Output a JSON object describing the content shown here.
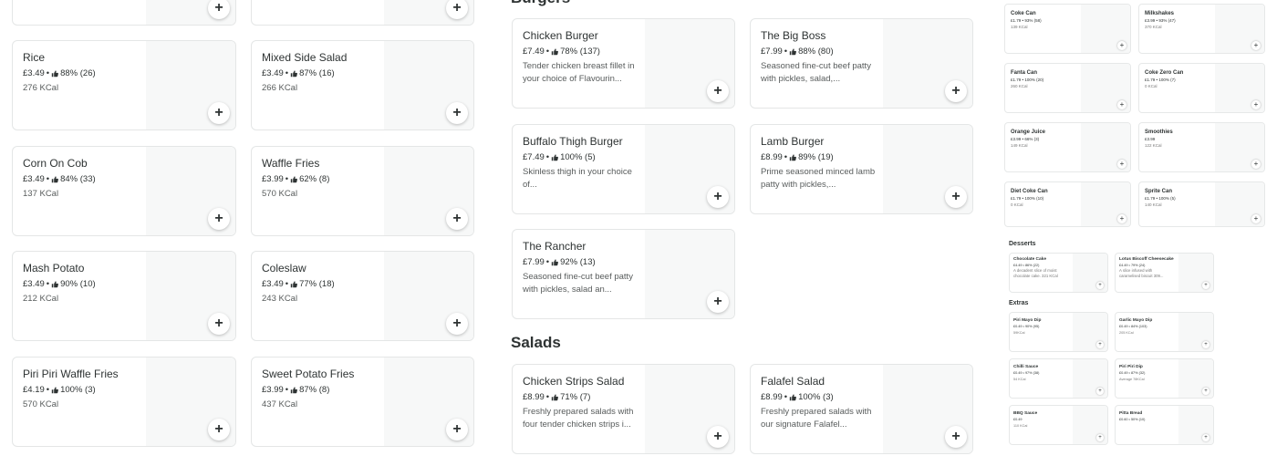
{
  "left_column": [
    {
      "name": "",
      "price": "",
      "rating": "",
      "kcal": ""
    },
    {
      "name": "Rice",
      "price": "£3.49",
      "rating": "88% (26)",
      "kcal": "276 KCal"
    },
    {
      "name": "Corn On Cob",
      "price": "£3.49",
      "rating": "84% (33)",
      "kcal": "137 KCal"
    },
    {
      "name": "Mash Potato",
      "price": "£3.49",
      "rating": "90% (10)",
      "kcal": "212 KCal"
    },
    {
      "name": "Piri Piri Waffle Fries",
      "price": "£4.19",
      "rating": "100% (3)",
      "kcal": "570 KCal"
    }
  ],
  "middle_column": [
    {
      "name": "Mixed Side Salad",
      "price": "£3.49",
      "rating": "87% (16)",
      "kcal": "266 KCal"
    },
    {
      "name": "Waffle Fries",
      "price": "£3.99",
      "rating": "62% (8)",
      "kcal": "570 KCal"
    },
    {
      "name": "Coleslaw",
      "price": "£3.49",
      "rating": "77% (18)",
      "kcal": "243 KCal"
    },
    {
      "name": "Sweet Potato Fries",
      "price": "£3.99",
      "rating": "87% (8)",
      "kcal": "437 KCal"
    }
  ],
  "burgers": {
    "title": "Burgers",
    "items": [
      {
        "name": "Chicken Burger",
        "price": "£7.49",
        "rating": "78% (137)",
        "desc": "Tender chicken breast fillet in your choice of Flavourin..."
      },
      {
        "name": "The Big Boss",
        "price": "£7.99",
        "rating": "88% (80)",
        "desc": "Seasoned fine-cut beef patty with pickles, salad,..."
      },
      {
        "name": "Buffalo Thigh Burger",
        "price": "£7.49",
        "rating": "100% (5)",
        "desc": "Skinless thigh in your choice of..."
      },
      {
        "name": "Lamb Burger",
        "price": "£8.99",
        "rating": "89% (19)",
        "desc": "Prime seasoned minced lamb patty with pickles,..."
      },
      {
        "name": "The Rancher",
        "price": "£7.99",
        "rating": "92% (13)",
        "desc": "Seasoned fine-cut beef patty with pickles, salad an..."
      }
    ]
  },
  "salads": {
    "title": "Salads",
    "items": [
      {
        "name": "Chicken Strips Salad",
        "price": "£8.99",
        "rating": "71% (7)",
        "desc": "Freshly prepared salads with four tender chicken strips i..."
      },
      {
        "name": "Falafel Salad",
        "price": "£8.99",
        "rating": "100% (3)",
        "desc": "Freshly prepared salads with our signature Falafel..."
      }
    ]
  },
  "drinks": [
    {
      "name": "Coke Can",
      "meta": "£1.79 • 93% (58)",
      "kcal": "139 KCal"
    },
    {
      "name": "Milkshakes",
      "meta": "£3.99 • 93% (47)",
      "kcal": "370 KCal"
    },
    {
      "name": "Fanta Can",
      "meta": "£1.79 • 100% (20)",
      "kcal": "260 KCal"
    },
    {
      "name": "Coke Zero Can",
      "meta": "£1.79 • 100% (7)",
      "kcal": "0 KCal"
    },
    {
      "name": "Orange Juice",
      "meta": "£3.99 • 66% (3)",
      "kcal": "149 KCal"
    },
    {
      "name": "Smoothies",
      "meta": "£3.99",
      "kcal": "122 KCal"
    },
    {
      "name": "Diet Coke Can",
      "meta": "£1.79 • 100% (10)",
      "kcal": "0 KCal"
    },
    {
      "name": "Sprite Can",
      "meta": "£1.79 • 100% (5)",
      "kcal": "140 KCal"
    }
  ],
  "desserts": {
    "title": "Desserts",
    "items": [
      {
        "name": "Chocolate Cake",
        "meta": "£4.49 • 86% (22)",
        "desc": "A decadent slice of moist chocolate cake. 321 KCal"
      },
      {
        "name": "Lotus Biscoff Cheesecake",
        "meta": "£4.49 • 79% (24)",
        "desc": "A slice infused with caramelised biscuit 309..."
      }
    ]
  },
  "extras": {
    "title": "Extras",
    "items": [
      {
        "name": "Piri Mayo Dip",
        "meta": "£0.49 • 90% (95)",
        "kcal": "59KCal"
      },
      {
        "name": "Garlic Mayo Dip",
        "meta": "£0.49 • 84% (103)",
        "kcal": "205 KCal"
      },
      {
        "name": "Chilli Sauce",
        "meta": "£0.49 • 97% (38)",
        "kcal": "54 KCal"
      },
      {
        "name": "Piri Piri Dip",
        "meta": "£0.49 • 87% (32)",
        "kcal": "Average 78KCal"
      },
      {
        "name": "BBQ Sauce",
        "meta": "£0.49",
        "kcal": "110 KCal"
      },
      {
        "name": "Pitta Bread",
        "meta": "£0.60 • 50% (10)",
        "kcal": ""
      }
    ]
  },
  "icons": {
    "add": "plus-icon",
    "rating": "thumbs-up-icon"
  },
  "add_symbol": "+"
}
